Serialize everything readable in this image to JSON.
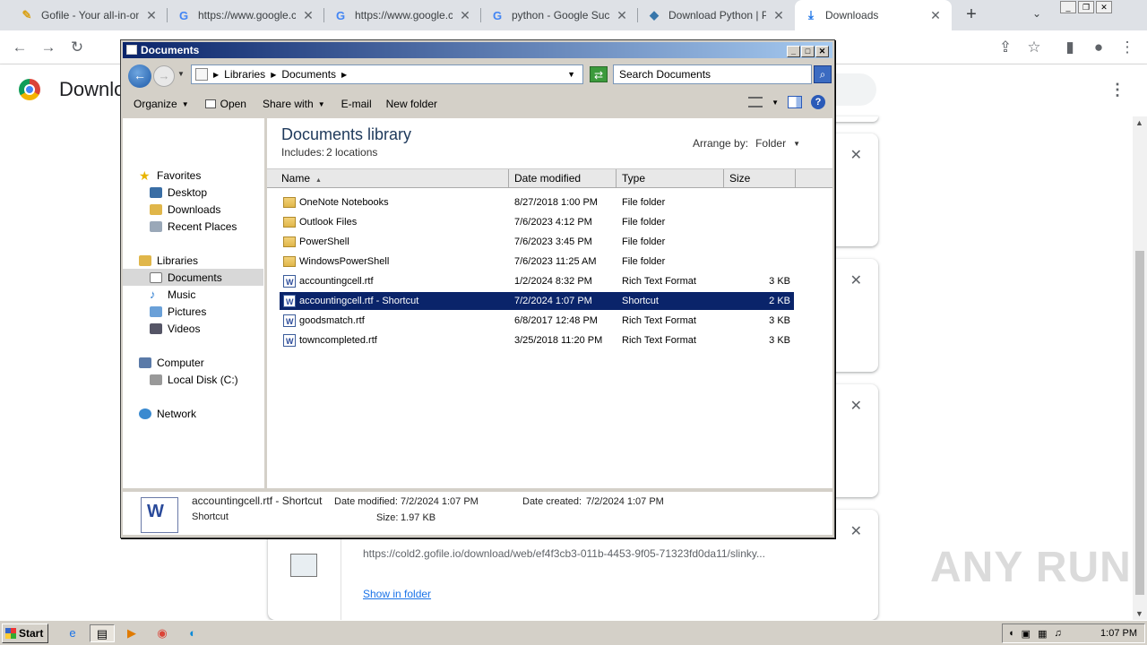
{
  "browser": {
    "tabs": [
      {
        "label": "Gofile - Your all-in-one",
        "icon": "gofile-icon"
      },
      {
        "label": "https://www.google.co",
        "icon": "google-icon"
      },
      {
        "label": "https://www.google.co",
        "icon": "google-icon"
      },
      {
        "label": "python - Google Suche",
        "icon": "google-icon"
      },
      {
        "label": "Download Python | Py",
        "icon": "python-icon"
      },
      {
        "label": "Downloads",
        "icon": "download-icon",
        "active": true
      }
    ],
    "page_title": "Downlo",
    "new_tab": "+",
    "tab_search": "⌄"
  },
  "downloads": {
    "last_card": {
      "url": "https://cold2.gofile.io/download/web/ef4f3cb3-011b-4453-9f05-71323fd0da11/slinky...",
      "show_in_folder": "Show in folder"
    }
  },
  "explorer": {
    "title": "Documents",
    "breadcrumb": [
      "Libraries",
      "Documents"
    ],
    "search_placeholder": "Search Documents",
    "commands": {
      "organize": "Organize",
      "open": "Open",
      "share_with": "Share with",
      "email": "E-mail",
      "new_folder": "New folder"
    },
    "nav": {
      "favorites": "Favorites",
      "desktop": "Desktop",
      "downloads": "Downloads",
      "recent": "Recent Places",
      "libraries": "Libraries",
      "documents": "Documents",
      "music": "Music",
      "pictures": "Pictures",
      "videos": "Videos",
      "computer": "Computer",
      "local_disk": "Local Disk (C:)",
      "network": "Network"
    },
    "library": {
      "title": "Documents library",
      "includes_label": "Includes:",
      "includes_value": "2 locations",
      "arrange_label": "Arrange by:",
      "arrange_value": "Folder"
    },
    "columns": {
      "name": "Name",
      "date": "Date modified",
      "type": "Type",
      "size": "Size"
    },
    "files": [
      {
        "name": "OneNote Notebooks",
        "date": "8/27/2018 1:00 PM",
        "type": "File folder",
        "size": "",
        "kind": "folder"
      },
      {
        "name": "Outlook Files",
        "date": "7/6/2023 4:12 PM",
        "type": "File folder",
        "size": "",
        "kind": "folder"
      },
      {
        "name": "PowerShell",
        "date": "7/6/2023 3:45 PM",
        "type": "File folder",
        "size": "",
        "kind": "folder"
      },
      {
        "name": "WindowsPowerShell",
        "date": "7/6/2023 11:25 AM",
        "type": "File folder",
        "size": "",
        "kind": "folder"
      },
      {
        "name": "accountingcell.rtf",
        "date": "1/2/2024 8:32 PM",
        "type": "Rich Text Format",
        "size": "3 KB",
        "kind": "doc"
      },
      {
        "name": "accountingcell.rtf - Shortcut",
        "date": "7/2/2024 1:07 PM",
        "type": "Shortcut",
        "size": "2 KB",
        "kind": "doc",
        "selected": true
      },
      {
        "name": "goodsmatch.rtf",
        "date": "6/8/2017 12:48 PM",
        "type": "Rich Text Format",
        "size": "3 KB",
        "kind": "doc"
      },
      {
        "name": "towncompleted.rtf",
        "date": "3/25/2018 11:20 PM",
        "type": "Rich Text Format",
        "size": "3 KB",
        "kind": "doc"
      }
    ],
    "details": {
      "name": "accountingcell.rtf - Shortcut",
      "type": "Shortcut",
      "modified_label": "Date modified:",
      "modified_value": "7/2/2024 1:07 PM",
      "created_label": "Date created:",
      "created_value": "7/2/2024 1:07 PM",
      "size_label": "Size:",
      "size_value": "1.97 KB"
    }
  },
  "taskbar": {
    "start": "Start",
    "clock": "1:07 PM"
  },
  "watermark": "ANY RUN"
}
